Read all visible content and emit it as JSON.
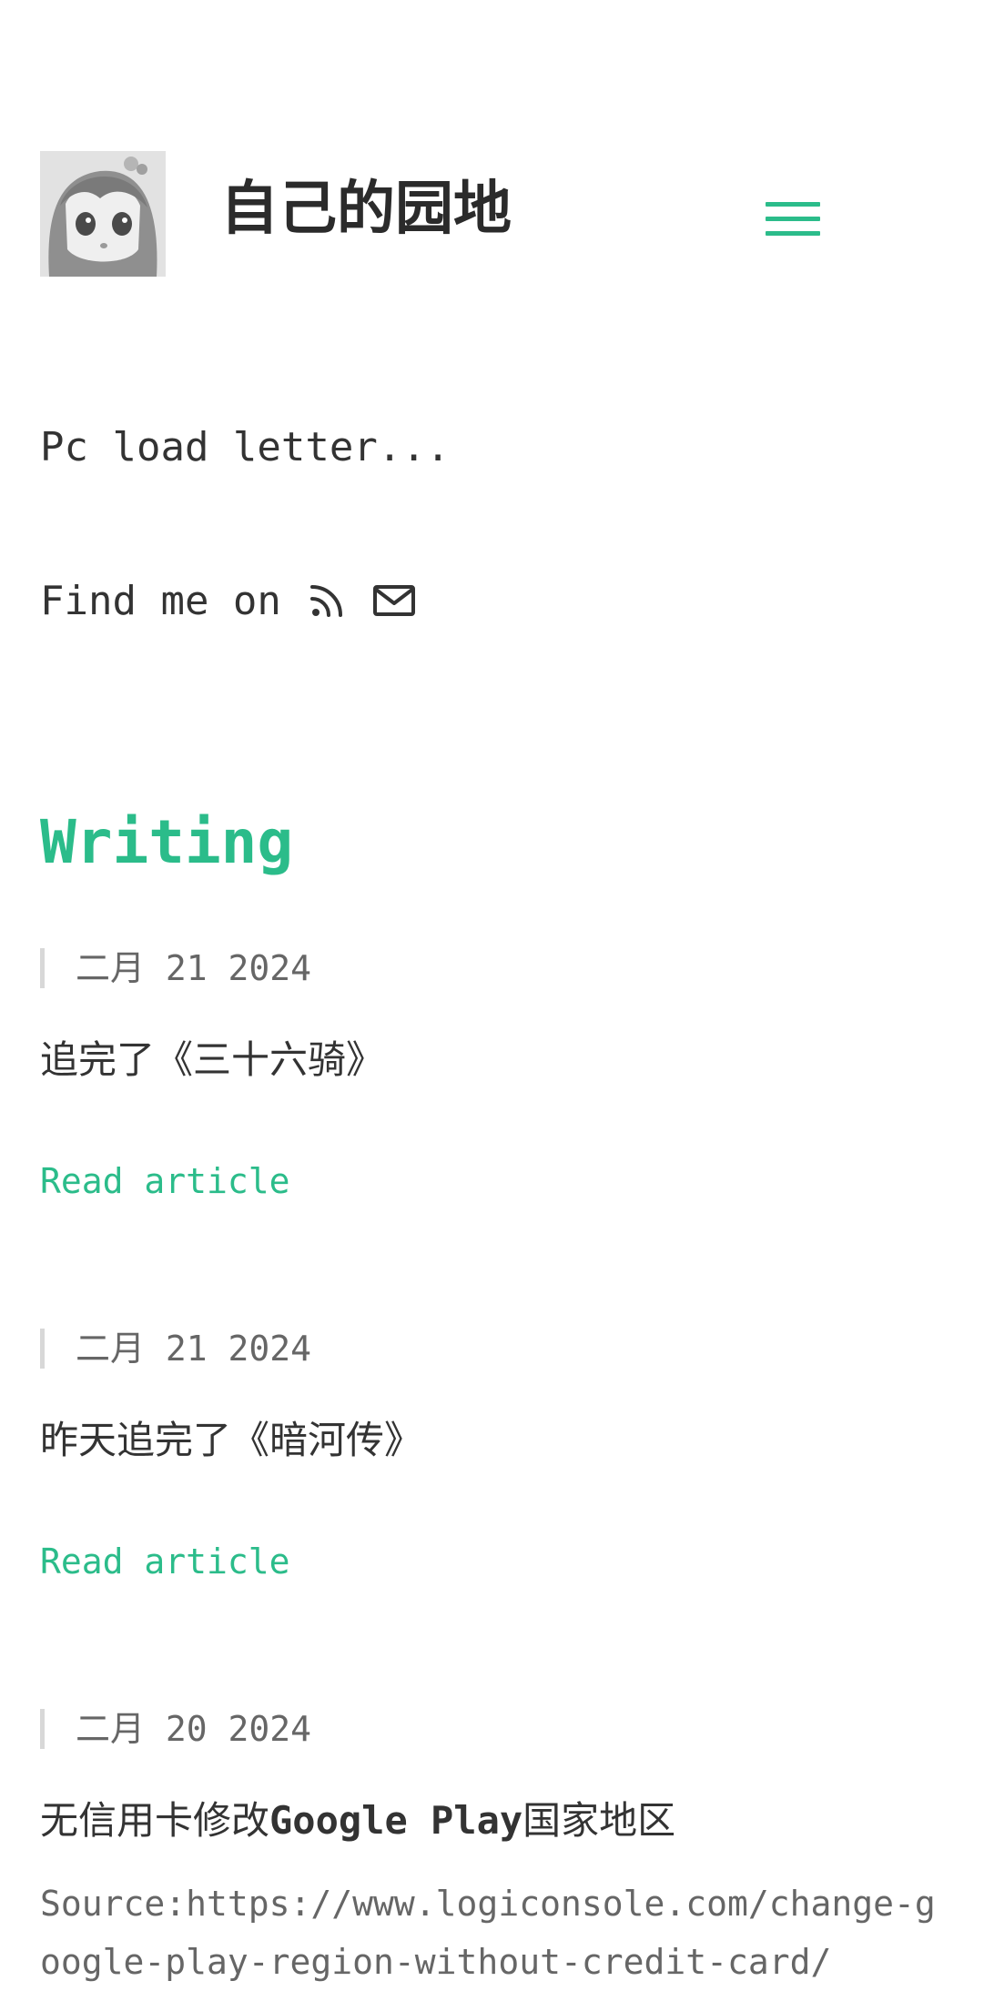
{
  "header": {
    "site_title": "自己的园地",
    "menu_icon": "hamburger-menu-icon",
    "accent_color": "#2bbc8a"
  },
  "about": {
    "tagline": "Pc load letter...",
    "find_me_label": "Find me on",
    "social_icons": [
      "rss-icon",
      "mail-icon"
    ]
  },
  "writing": {
    "section_title": "Writing",
    "posts": [
      {
        "date": "二月 21 2024",
        "title": "追完了《三十六骑》",
        "read_more": "Read article"
      },
      {
        "date": "二月 21 2024",
        "title": "昨天追完了《暗河传》",
        "read_more": "Read article"
      },
      {
        "date": "二月 20 2024",
        "title_prefix": "无信用卡修改",
        "title_brand": "Google Play",
        "title_suffix": "国家地区",
        "excerpt": "Source:https://www.logiconsole.com/change-google-play-region-without-credit-card/"
      }
    ]
  }
}
